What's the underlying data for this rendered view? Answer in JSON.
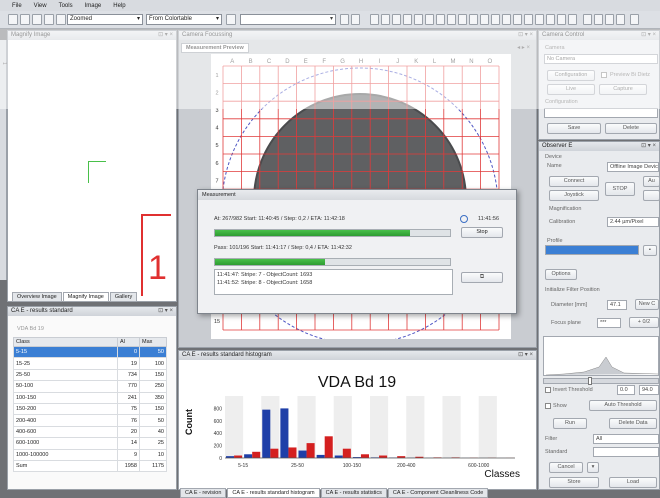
{
  "menu": [
    "File",
    "View",
    "Tools",
    "Image",
    "Help"
  ],
  "toolbar": {
    "zoom_combo": "Zoomed",
    "source_combo": "From Colortable"
  },
  "panels": {
    "magnify_title": "Magnify Image",
    "focusing_title": "Camera Focussing",
    "camera_control_title": "Camera Control",
    "observer_title": "Observer E",
    "results_standard_title": "CA E - results standard",
    "histogram_title": "CA E - results standard histogram"
  },
  "magnify": {
    "big_digit": "1",
    "tabs": [
      "Overview Image",
      "Magnify Image",
      "Gallery"
    ],
    "side_label": "1"
  },
  "measurement_preview_tab": "Measurement Preview",
  "grid": {
    "col_letters": [
      "A",
      "B",
      "C",
      "D",
      "E",
      "F",
      "G",
      "H",
      "I",
      "J",
      "K",
      "L",
      "M",
      "N",
      "O"
    ],
    "row_numbers": [
      "1",
      "2",
      "3",
      "4",
      "5",
      "6",
      "7",
      "8",
      "9",
      "10",
      "11",
      "12",
      "13",
      "14",
      "15"
    ]
  },
  "dialog": {
    "title": "Measurement",
    "line1": "At: 267/982 Start: 11:40:45 / Step: 0,2 / ETA: 11:42:18",
    "line1_time": "11:41:56",
    "progress1": 0.83,
    "stop_label": "Stop",
    "line2": "Pass: 101/196 Start: 11:41:17 / Step: 0,4 / ETA: 11:42:32",
    "progress2": 0.47,
    "log": [
      "11:41:47: Stripe: 7 - ObjectCount: 1693",
      "11:41:52: Stripe: 8 - ObjectCount: 1658"
    ]
  },
  "results": {
    "title": "VDA Bd 19",
    "columns": [
      "Class",
      "Al",
      "Max"
    ],
    "rows": [
      {
        "cls": "5-15",
        "al": "0",
        "max": "50"
      },
      {
        "cls": "15-25",
        "al": "19",
        "max": "100"
      },
      {
        "cls": "25-50",
        "al": "734",
        "max": "150"
      },
      {
        "cls": "50-100",
        "al": "770",
        "max": "250"
      },
      {
        "cls": "100-150",
        "al": "241",
        "max": "350"
      },
      {
        "cls": "150-200",
        "al": "75",
        "max": "150"
      },
      {
        "cls": "200-400",
        "al": "76",
        "max": "50"
      },
      {
        "cls": "400-600",
        "al": "20",
        "max": "40"
      },
      {
        "cls": "600-1000",
        "al": "14",
        "max": "25"
      },
      {
        "cls": "1000-100000",
        "al": "9",
        "max": "10"
      },
      {
        "cls": "Sum",
        "al": "1958",
        "max": "1175"
      }
    ]
  },
  "chart_data": {
    "type": "bar",
    "title": "VDA Bd 19",
    "ylabel": "Count",
    "xlabel": "Classes",
    "tick_labels": [
      "5-15",
      "25-50",
      "100-150",
      "200-400",
      "600-1000"
    ],
    "ylim": [
      0,
      1000
    ],
    "y_ticks": [
      "800",
      "600",
      "400",
      "200",
      "0"
    ],
    "series": [
      {
        "color": "#1f3fa8",
        "values": [
          30,
          60,
          780,
          800,
          120,
          50,
          40,
          15,
          10,
          8,
          5,
          3,
          2,
          2,
          1,
          1
        ]
      },
      {
        "color": "#d42020",
        "values": [
          40,
          100,
          150,
          170,
          240,
          350,
          150,
          60,
          40,
          30,
          20,
          10,
          10,
          5,
          4,
          2
        ]
      }
    ]
  },
  "bottom_tabs": [
    "CA E - revision",
    "CA E - results standard histogram",
    "CA E - results statistics",
    "CA E - Component Cleanliness Code"
  ],
  "camera": {
    "group_label": "Camera",
    "camera_value": "No Camera",
    "configuration_btn": "Configuration",
    "preview_check": "Preview Bi Dietz",
    "live_btn": "Live",
    "capture_btn": "Capture",
    "configuration_label": "Configuration",
    "save_btn": "Save",
    "delete_btn": "Delete"
  },
  "observer": {
    "device_label": "Device",
    "name_label": "Name",
    "name_value": "Offline Image Device",
    "connect_btn": "Connect",
    "au_btn": "Au",
    "stop_btn": "STOP",
    "joystick_btn": "Joystick",
    "magnification_label": "Magnification",
    "calibration_label": "Calibration",
    "calibration_value": "2.44 µm/Pixel",
    "profile_label": "Profile",
    "options_btn": "Options",
    "filter_section": "Initialize Filter Position",
    "diameter_label": "Diameter [mm]",
    "diameter_value": "47.1",
    "new_btn": "New C",
    "focus_label": "Focus plane",
    "focus_value": "***",
    "plus_btn": "+ 0/2",
    "invert_label": "Invert Threshold",
    "thr_a": "0.0",
    "thr_b": "94.0",
    "show_label": "Show",
    "auto_btn": "Auto Threshold",
    "run_btn": "Run",
    "delete_data_btn": "Delete Data",
    "filter_label": "Filter",
    "filter_value": "All",
    "standard_label": "Standard",
    "cancel_btn": "Cancel",
    "store_btn": "Store",
    "load_btn": "Load"
  }
}
